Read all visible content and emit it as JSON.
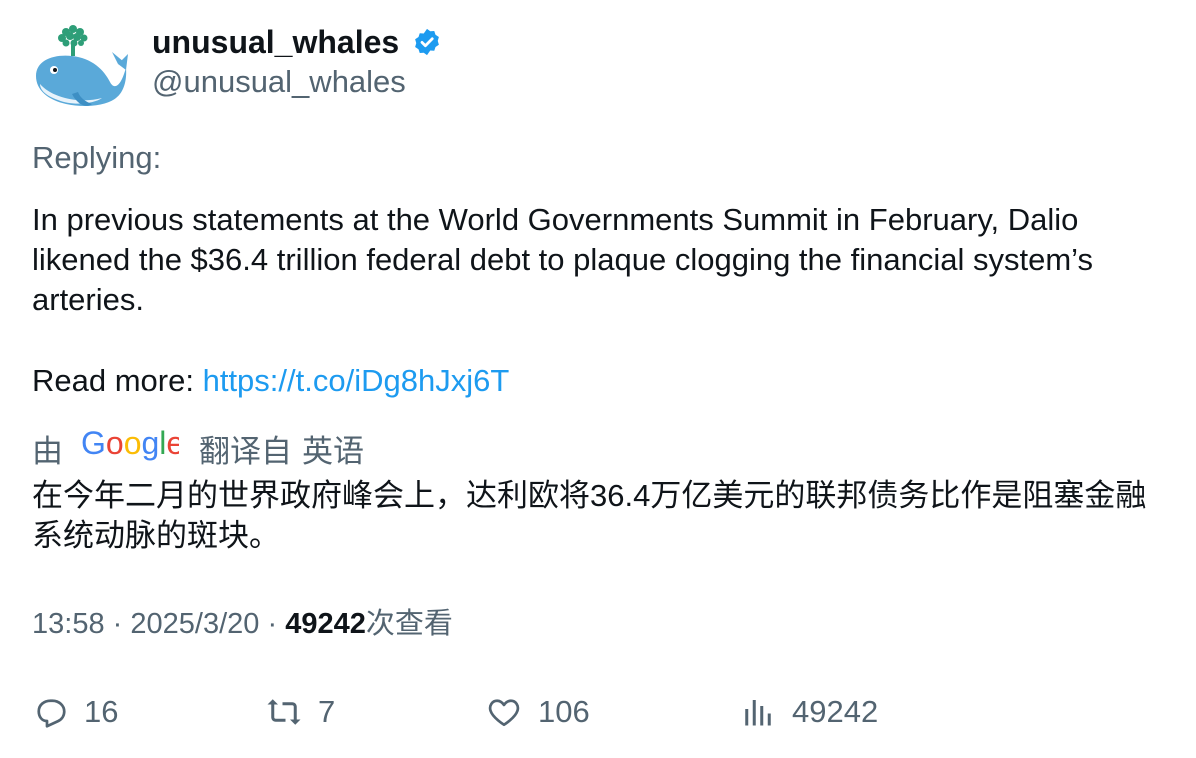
{
  "author": {
    "display_name": "unusual_whales",
    "handle": "@unusual_whales",
    "verified_icon": "verified-badge-icon",
    "avatar_icon": "whale-avatar-icon"
  },
  "reply": {
    "label": "Replying:"
  },
  "tweet": {
    "text": "In previous statements at the World Governments Summit in February, Dalio likened the $36.4 trillion federal debt to plaque clogging the financial system’s arteries.",
    "read_more_label": "Read more:",
    "link": "https://t.co/iDg8hJxj6T"
  },
  "translation": {
    "by": "由",
    "logo_text": "Google",
    "from": "翻译自",
    "language": "英语",
    "text": "在今年二月的世界政府峰会上，达利欧将36.4万亿美元的联邦债务比作是阻塞金融系统动脉的斑块。"
  },
  "meta": {
    "time": "13:58",
    "separator": "·",
    "date": "2025/3/20",
    "views_count": "49242",
    "views_label": "次查看"
  },
  "actions": {
    "replies": "16",
    "reposts": "7",
    "likes": "106",
    "views": "49242"
  },
  "colors": {
    "link": "#1d9bf0",
    "secondary_text": "#536471",
    "primary_text": "#0f1419",
    "verified": "#1d9bf0"
  }
}
